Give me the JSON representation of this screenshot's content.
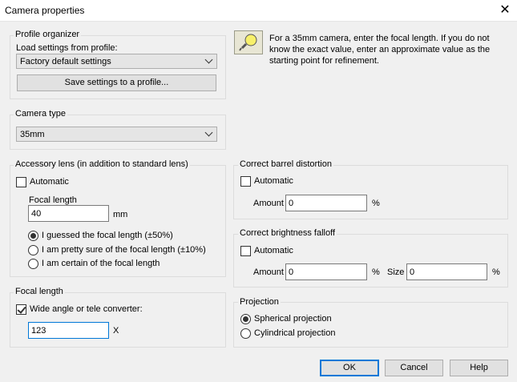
{
  "window": {
    "title": "Camera properties",
    "close_glyph": "✕"
  },
  "profile": {
    "legend": "Profile organizer",
    "load_label": "Load settings from profile:",
    "selected": "Factory default settings",
    "save_button": "Save settings to a profile..."
  },
  "tip": {
    "icon": "lightbulb-icon",
    "line1": "For a 35mm camera, enter the focal length.  If you do not",
    "line2": "know the exact value, enter an approximate value as the",
    "line3": "starting point for refinement."
  },
  "camera_type": {
    "legend": "Camera type",
    "selected": "35mm"
  },
  "accessory": {
    "legend": "Accessory lens (in addition to standard lens)",
    "automatic_label": "Automatic",
    "automatic_checked": false,
    "focal_label": "Focal length",
    "focal_value": "40",
    "focal_unit": "mm",
    "options": [
      {
        "label": "I guessed the focal length (±50%)",
        "selected": true
      },
      {
        "label": "I am pretty sure of the focal length (±10%)",
        "selected": false
      },
      {
        "label": "I am certain of the focal length",
        "selected": false
      }
    ]
  },
  "barrel": {
    "legend": "Correct barrel distortion",
    "automatic_label": "Automatic",
    "automatic_checked": false,
    "amount_label": "Amount",
    "amount_value": "0",
    "unit": "%"
  },
  "brightness": {
    "legend": "Correct brightness falloff",
    "automatic_label": "Automatic",
    "automatic_checked": false,
    "amount_label": "Amount",
    "amount_value": "0",
    "amount_unit": "%",
    "size_label": "Size",
    "size_value": "0",
    "size_unit": "%"
  },
  "focal": {
    "legend": "Focal length",
    "converter_label": "Wide angle or tele converter:",
    "converter_checked": true,
    "value": "123",
    "unit": "X"
  },
  "projection": {
    "legend": "Projection",
    "options": [
      {
        "label": "Spherical projection",
        "selected": true
      },
      {
        "label": "Cylindrical projection",
        "selected": false
      }
    ]
  },
  "buttons": {
    "ok": "OK",
    "cancel": "Cancel",
    "help": "Help"
  }
}
